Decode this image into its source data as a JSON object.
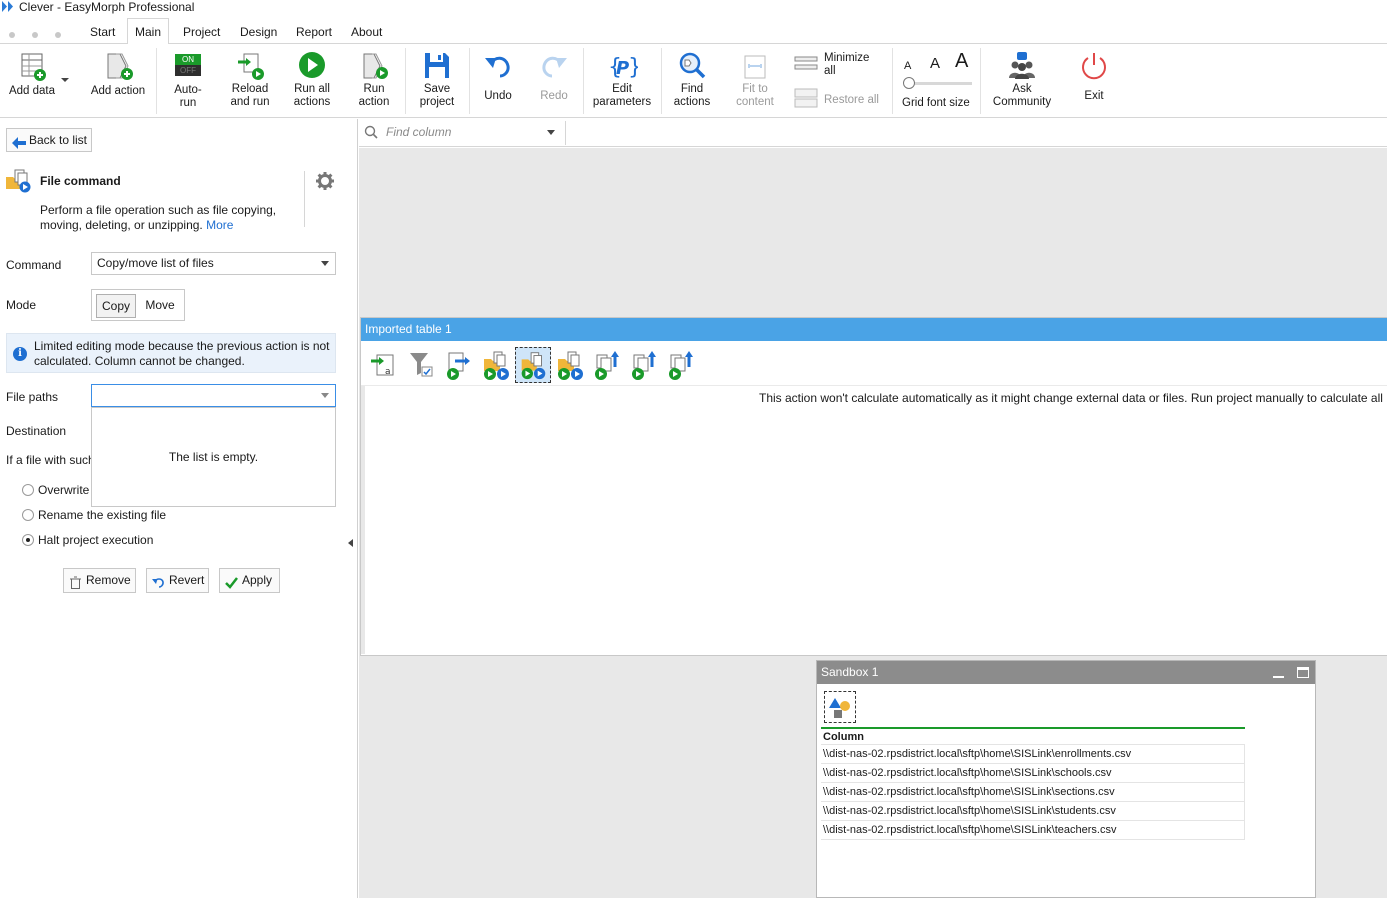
{
  "window": {
    "title": "Clever - EasyMorph Professional"
  },
  "menu": {
    "tabs": [
      "Start",
      "Main",
      "Project",
      "Design",
      "Report",
      "About"
    ],
    "active": "Main"
  },
  "ribbon": {
    "add_data": "Add data",
    "add_action": "Add action",
    "auto_run_1": "Auto-",
    "auto_run_2": "run",
    "auto_run_on": "ON",
    "auto_run_off": "OFF",
    "reload_1": "Reload",
    "reload_2": "and run",
    "run_all_1": "Run all",
    "run_all_2": "actions",
    "run_action_1": "Run",
    "run_action_2": "action",
    "save_1": "Save",
    "save_2": "project",
    "undo": "Undo",
    "redo": "Redo",
    "edit_params_1": "Edit",
    "edit_params_2": "parameters",
    "find_actions_1": "Find",
    "find_actions_2": "actions",
    "fit_1": "Fit to",
    "fit_2": "content",
    "minimize_1": "Minimize",
    "minimize_2": "all",
    "restore_all": "Restore all",
    "font_a_small": "A",
    "font_a_mid": "A",
    "font_a_big": "A",
    "grid_font_size": "Grid font size",
    "ask_1": "Ask",
    "ask_2": "Community",
    "exit": "Exit"
  },
  "left_panel": {
    "back_label": "Back to list",
    "title": "File command",
    "description": "Perform a file operation such as file copying, moving, deleting, or unzipping.",
    "more_link": "More",
    "command_label": "Command",
    "command_value": "Copy/move list of files",
    "mode_label": "Mode",
    "mode_copy": "Copy",
    "mode_move": "Move",
    "info_text": "Limited editing mode because the previous action is not calculated. Column cannot be changed.",
    "file_paths_label": "File paths",
    "file_paths_value": "",
    "list_empty": "The list is empty.",
    "destination_label": "Destination",
    "if_file_label": "If a file with such",
    "radio_overwrite": "Overwrite",
    "radio_rename": "Rename the existing file",
    "radio_halt": "Halt project execution",
    "remove_btn": "Remove",
    "revert_btn": "Revert",
    "apply_btn": "Apply"
  },
  "find_column": {
    "placeholder": "Find column"
  },
  "table_panel": {
    "title": "Imported table 1",
    "message": "This action won't calculate automatically as it might change external data or files. Run project manually to calculate all i"
  },
  "sandbox": {
    "title": "Sandbox 1",
    "column_header": "Column",
    "rows": [
      "\\\\dist-nas-02.rpsdistrict.local\\sftp\\home\\SISLink\\enrollments.csv",
      "\\\\dist-nas-02.rpsdistrict.local\\sftp\\home\\SISLink\\schools.csv",
      "\\\\dist-nas-02.rpsdistrict.local\\sftp\\home\\SISLink\\sections.csv",
      "\\\\dist-nas-02.rpsdistrict.local\\sftp\\home\\SISLink\\students.csv",
      "\\\\dist-nas-02.rpsdistrict.local\\sftp\\home\\SISLink\\teachers.csv"
    ]
  },
  "colors": {
    "accent_blue": "#1f6fd1",
    "table_header": "#4aa3e6",
    "sandbox_header": "#8c8c8c",
    "run_green": "#1a9a2a",
    "exit_red": "#e04848"
  }
}
